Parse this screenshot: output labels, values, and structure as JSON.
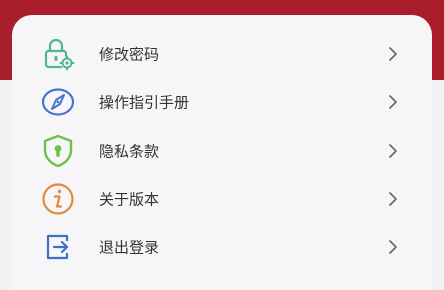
{
  "colors": {
    "header": "#a81e2b",
    "card": "#f6f6f8",
    "text": "#333333",
    "chevron": "#666666"
  },
  "menu": {
    "items": [
      {
        "label": "修改密码",
        "icon": "lock-settings-icon",
        "icon_color": "#4fb68f"
      },
      {
        "label": "操作指引手册",
        "icon": "compass-icon",
        "icon_color": "#4a73c9"
      },
      {
        "label": "隐私条款",
        "icon": "shield-lock-icon",
        "icon_color": "#6fbf4a"
      },
      {
        "label": "关于版本",
        "icon": "info-icon",
        "icon_color": "#e08a3c"
      },
      {
        "label": "退出登录",
        "icon": "logout-icon",
        "icon_color": "#3f72c4"
      }
    ]
  }
}
